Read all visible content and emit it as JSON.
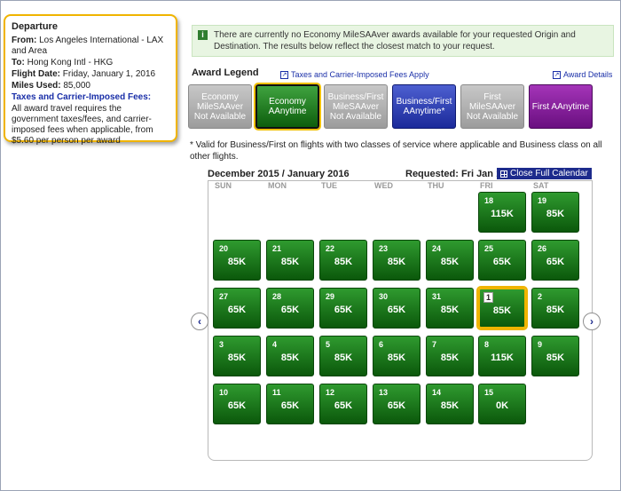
{
  "departure": {
    "title": "Departure",
    "from_label": "From:",
    "from_value": "Los Angeles International - LAX and Area",
    "to_label": "To:",
    "to_value": "Hong Kong Intl - HKG",
    "date_label": "Flight Date:",
    "date_value": "Friday, January 1, 2016",
    "miles_label": "Miles Used:",
    "miles_value": "85,000",
    "taxes_heading": "Taxes and Carrier-Imposed Fees:",
    "taxes_text": "All award travel requires the government taxes/fees, and carrier-imposed fees when applicable, from $5.60 per person per award"
  },
  "notice": {
    "icon_text": "i",
    "text": "There are currently no Economy MileSAAver awards available for your requested Origin and Destination. The results below reflect the closest match to your request."
  },
  "legend": {
    "title": "Award Legend",
    "taxes_link": "Taxes and Carrier-Imposed Fees Apply",
    "details_link": "Award Details",
    "items": [
      {
        "label": "Economy MileSAAver Not Available",
        "style": "gray"
      },
      {
        "label": "Economy AAnytime",
        "style": "green"
      },
      {
        "label": "Business/First MileSAAver Not Available",
        "style": "gray"
      },
      {
        "label": "Business/First AAnytime*",
        "style": "blue"
      },
      {
        "label": "First MileSAAver Not Available",
        "style": "gray"
      },
      {
        "label": "First AAnytime",
        "style": "purple"
      }
    ]
  },
  "valid_note": "* Valid for Business/First on flights with two classes of service where applicable and Business class on all other flights.",
  "calendar": {
    "heading": "December 2015 / January 2016",
    "requested": "Requested: Fri Jan 1",
    "close_label": "Close Full Calendar",
    "weekdays": [
      "SUN",
      "MON",
      "TUE",
      "WED",
      "THU",
      "FRI",
      "SAT"
    ],
    "prev_label": "‹",
    "next_label": "›",
    "days": [
      {
        "day": "18",
        "miles": "115K",
        "col": 5,
        "row": 0
      },
      {
        "day": "19",
        "miles": "85K",
        "col": 6,
        "row": 0
      },
      {
        "day": "20",
        "miles": "85K",
        "col": 0,
        "row": 1
      },
      {
        "day": "21",
        "miles": "85K",
        "col": 1,
        "row": 1
      },
      {
        "day": "22",
        "miles": "85K",
        "col": 2,
        "row": 1
      },
      {
        "day": "23",
        "miles": "85K",
        "col": 3,
        "row": 1
      },
      {
        "day": "24",
        "miles": "85K",
        "col": 4,
        "row": 1
      },
      {
        "day": "25",
        "miles": "65K",
        "col": 5,
        "row": 1
      },
      {
        "day": "26",
        "miles": "65K",
        "col": 6,
        "row": 1
      },
      {
        "day": "27",
        "miles": "65K",
        "col": 0,
        "row": 2
      },
      {
        "day": "28",
        "miles": "65K",
        "col": 1,
        "row": 2
      },
      {
        "day": "29",
        "miles": "65K",
        "col": 2,
        "row": 2
      },
      {
        "day": "30",
        "miles": "65K",
        "col": 3,
        "row": 2
      },
      {
        "day": "31",
        "miles": "85K",
        "col": 4,
        "row": 2
      },
      {
        "day": "1",
        "miles": "85K",
        "col": 5,
        "row": 2,
        "selected": true
      },
      {
        "day": "2",
        "miles": "85K",
        "col": 6,
        "row": 2
      },
      {
        "day": "3",
        "miles": "85K",
        "col": 0,
        "row": 3
      },
      {
        "day": "4",
        "miles": "85K",
        "col": 1,
        "row": 3
      },
      {
        "day": "5",
        "miles": "85K",
        "col": 2,
        "row": 3
      },
      {
        "day": "6",
        "miles": "85K",
        "col": 3,
        "row": 3
      },
      {
        "day": "7",
        "miles": "85K",
        "col": 4,
        "row": 3
      },
      {
        "day": "8",
        "miles": "115K",
        "col": 5,
        "row": 3
      },
      {
        "day": "9",
        "miles": "85K",
        "col": 6,
        "row": 3
      },
      {
        "day": "10",
        "miles": "65K",
        "col": 0,
        "row": 4
      },
      {
        "day": "11",
        "miles": "65K",
        "col": 1,
        "row": 4
      },
      {
        "day": "12",
        "miles": "65K",
        "col": 2,
        "row": 4
      },
      {
        "day": "13",
        "miles": "65K",
        "col": 3,
        "row": 4
      },
      {
        "day": "14",
        "miles": "85K",
        "col": 4,
        "row": 4
      },
      {
        "day": "15",
        "miles": "0K",
        "col": 5,
        "row": 4
      }
    ]
  }
}
